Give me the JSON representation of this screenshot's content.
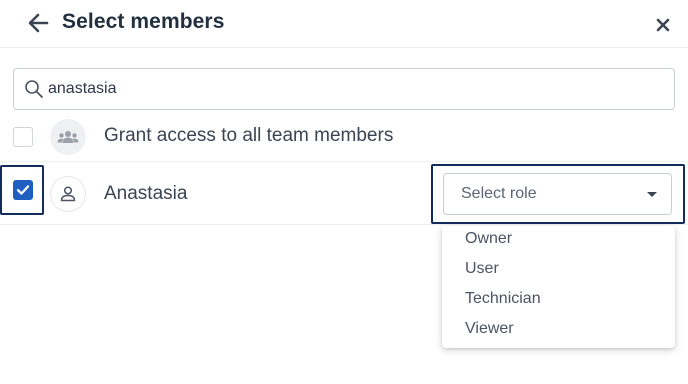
{
  "header": {
    "title": "Select members"
  },
  "search": {
    "value": "anastasia",
    "placeholder": ""
  },
  "rows": [
    {
      "label": "Grant access to all team members",
      "checked": false,
      "icon": "team-icon"
    },
    {
      "label": "Anastasia",
      "checked": true,
      "icon": "user-icon"
    }
  ],
  "role_select": {
    "placeholder": "Select role",
    "options": [
      "Owner",
      "User",
      "Technician",
      "Viewer"
    ]
  },
  "colors": {
    "accent": "#1f5fbf",
    "focus_outline": "#132c5e",
    "title": "#22303f"
  }
}
